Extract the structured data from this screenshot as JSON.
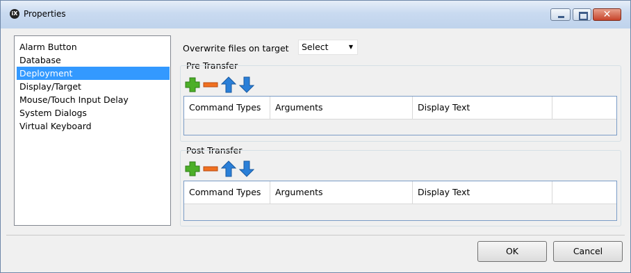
{
  "window": {
    "title": "Properties",
    "logo": "iX"
  },
  "sidebar": {
    "items": [
      {
        "label": "Alarm Button"
      },
      {
        "label": "Database"
      },
      {
        "label": "Deployment",
        "selected": true
      },
      {
        "label": "Display/Target"
      },
      {
        "label": "Mouse/Touch Input Delay"
      },
      {
        "label": "System Dialogs"
      },
      {
        "label": "Virtual Keyboard"
      }
    ]
  },
  "deployment": {
    "overwrite_label": "Overwrite files on target",
    "overwrite_value": "Select",
    "pre_transfer": {
      "label": "Pre Transfer",
      "columns": [
        "Command Types",
        "Arguments",
        "Display Text",
        ""
      ]
    },
    "post_transfer": {
      "label": "Post Transfer",
      "columns": [
        "Command Types",
        "Arguments",
        "Display Text",
        ""
      ]
    }
  },
  "toolbar_icons": [
    "add-icon",
    "remove-icon",
    "move-up-icon",
    "move-down-icon"
  ],
  "footer": {
    "ok_label": "OK",
    "cancel_label": "Cancel"
  },
  "colors": {
    "selection": "#3399ff",
    "titlebar": "#c9daf0",
    "add": "#4caf28",
    "remove": "#f07020",
    "arrow": "#2a7fd8"
  }
}
